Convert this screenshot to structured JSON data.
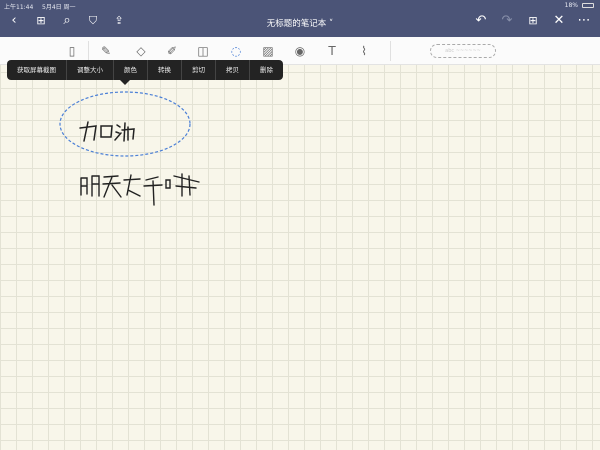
{
  "status": {
    "time": "上午11:44",
    "date": "5月4日 周一",
    "battery": "18%"
  },
  "header": {
    "title": "无标题的笔记本"
  },
  "context_menu": [
    "获取屏幕截图",
    "调整大小",
    "颜色",
    "转换",
    "剪切",
    "拷贝",
    "删除"
  ],
  "lasso_placeholder": "abc ~~~~~~",
  "colors": {
    "header": "#4b5477",
    "paper": "#f8f6ea",
    "lasso": "#4a7fd6"
  }
}
